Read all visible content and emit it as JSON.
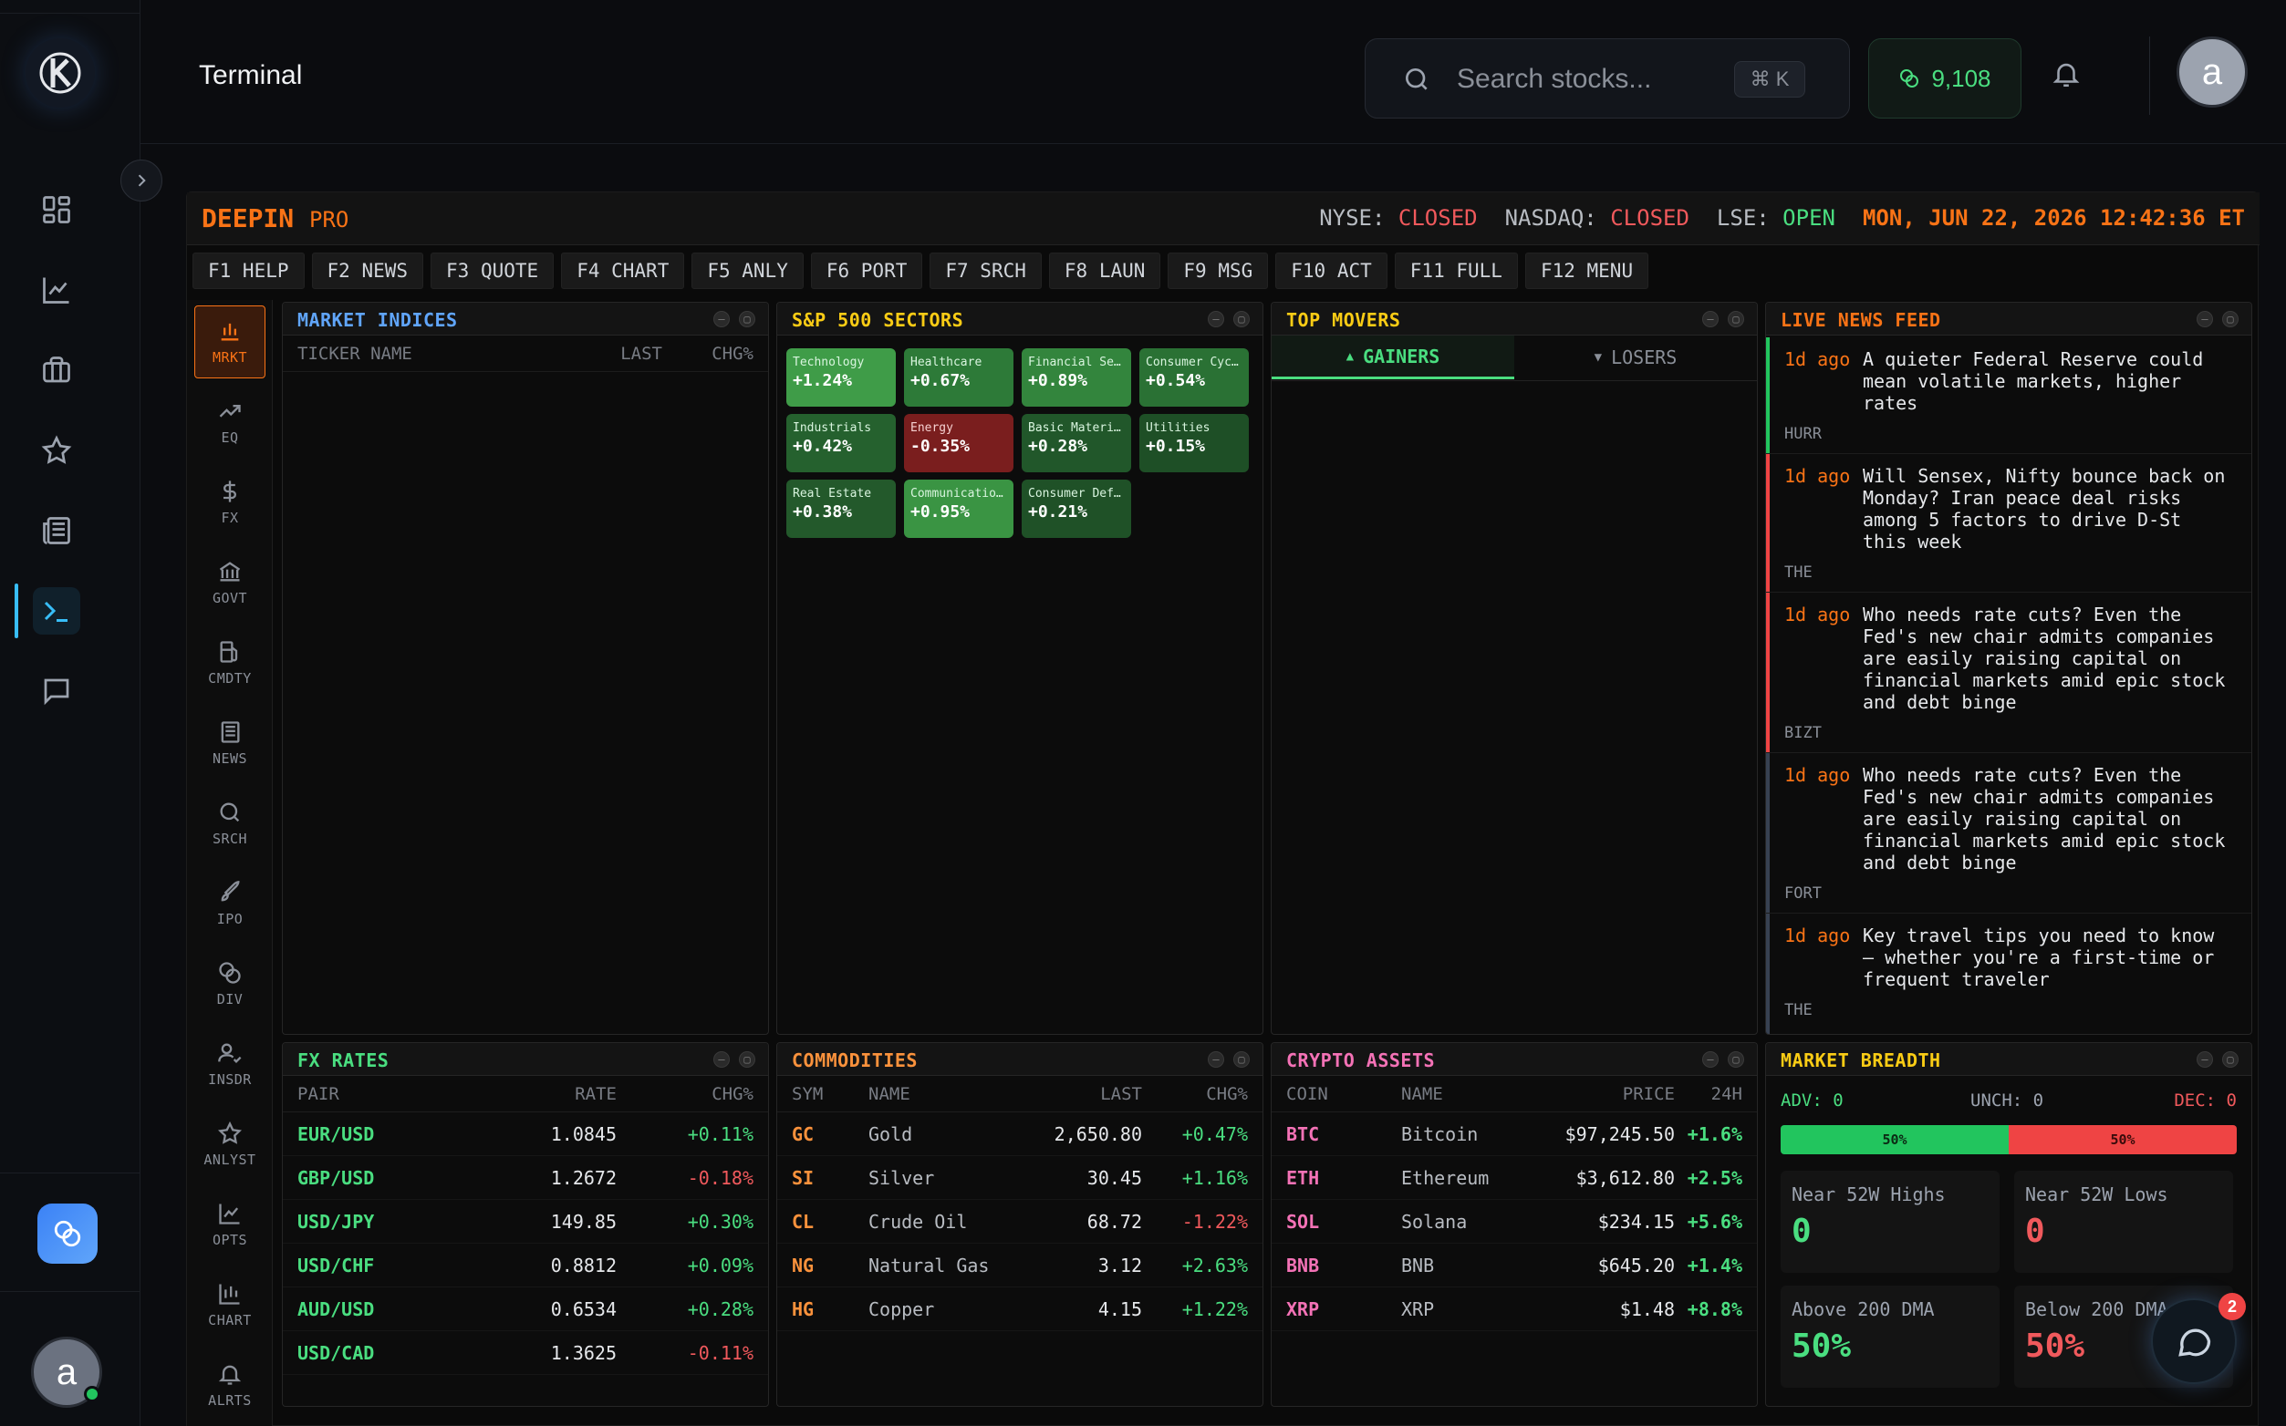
{
  "app": {
    "title": "Terminal",
    "avatar_initial": "a"
  },
  "search": {
    "placeholder": "Search stocks...",
    "shortcut": "⌘ K"
  },
  "credits": {
    "value": "9,108"
  },
  "rail_icons": [
    "dashboard-icon",
    "chart-line-icon",
    "portfolio-icon",
    "star-icon",
    "news-icon",
    "terminal-icon",
    "chat-icon"
  ],
  "terminal": {
    "brand": "DEEPIN",
    "tier": "PRO",
    "markets": [
      {
        "label": "NYSE:",
        "status": "CLOSED"
      },
      {
        "label": "NASDAQ:",
        "status": "CLOSED"
      },
      {
        "label": "LSE:",
        "status": "OPEN"
      }
    ],
    "clock": "MON, JUN 22, 2026 12:42:36 ET",
    "function_keys": [
      "F1 HELP",
      "F2 NEWS",
      "F3 QUOTE",
      "F4 CHART",
      "F5 ANLY",
      "F6 PORT",
      "F7 SRCH",
      "F8 LAUN",
      "F9 MSG",
      "F10 ACT",
      "F11 FULL",
      "F12 MENU"
    ],
    "functions": [
      "MRKT",
      "EQ",
      "FX",
      "GOVT",
      "CMDTY",
      "NEWS",
      "SRCH",
      "IPO",
      "DIV",
      "INSDR",
      "ANLYST",
      "OPTS",
      "CHART",
      "ALRTS"
    ]
  },
  "market_indices": {
    "title": "MARKET INDICES",
    "columns": [
      "TICKER NAME",
      "LAST",
      "CHG%"
    ]
  },
  "sectors": {
    "title": "S&P 500 SECTORS",
    "items": [
      {
        "name": "Technology",
        "change": "+1.24%"
      },
      {
        "name": "Healthcare",
        "change": "+0.67%"
      },
      {
        "name": "Financial Ser…",
        "change": "+0.89%"
      },
      {
        "name": "Consumer Cycl…",
        "change": "+0.54%"
      },
      {
        "name": "Industrials",
        "change": "+0.42%"
      },
      {
        "name": "Energy",
        "change": "-0.35%"
      },
      {
        "name": "Basic Materia…",
        "change": "+0.28%"
      },
      {
        "name": "Utilities",
        "change": "+0.15%"
      },
      {
        "name": "Real Estate",
        "change": "+0.38%"
      },
      {
        "name": "Communication…",
        "change": "+0.95%"
      },
      {
        "name": "Consumer Defe…",
        "change": "+0.21%"
      }
    ]
  },
  "movers": {
    "title": "TOP MOVERS",
    "tabs": [
      "GAINERS",
      "LOSERS"
    ]
  },
  "news": {
    "title": "LIVE NEWS FEED",
    "items": [
      {
        "age": "1d ago",
        "headline": "A quieter Federal Reserve could mean volatile markets, higher rates",
        "source": "HURR"
      },
      {
        "age": "1d ago",
        "headline": "Will Sensex, Nifty bounce back on Monday? Iran peace deal risks among 5 factors to drive D-St this week",
        "source": "THE"
      },
      {
        "age": "1d ago",
        "headline": "Who needs rate cuts? Even the Fed's new chair admits companies are easily raising capital on financial markets amid epic stock and debt binge",
        "source": "BIZT"
      },
      {
        "age": "1d ago",
        "headline": "Who needs rate cuts? Even the Fed's new chair admits companies are easily raising capital on financial markets amid epic stock and debt binge",
        "source": "FORT"
      },
      {
        "age": "1d ago",
        "headline": "Key travel tips you need to know — whether you're a first-time or frequent traveler",
        "source": "THE"
      }
    ]
  },
  "fx": {
    "title": "FX RATES",
    "columns": [
      "PAIR",
      "RATE",
      "CHG%"
    ],
    "rows": [
      {
        "pair": "EUR/USD",
        "rate": "1.0845",
        "chg": "+0.11%"
      },
      {
        "pair": "GBP/USD",
        "rate": "1.2672",
        "chg": "-0.18%"
      },
      {
        "pair": "USD/JPY",
        "rate": "149.85",
        "chg": "+0.30%"
      },
      {
        "pair": "USD/CHF",
        "rate": "0.8812",
        "chg": "+0.09%"
      },
      {
        "pair": "AUD/USD",
        "rate": "0.6534",
        "chg": "+0.28%"
      },
      {
        "pair": "USD/CAD",
        "rate": "1.3625",
        "chg": "-0.11%"
      }
    ]
  },
  "commodities": {
    "title": "COMMODITIES",
    "columns": [
      "SYM",
      "NAME",
      "LAST",
      "CHG%"
    ],
    "rows": [
      {
        "sym": "GC",
        "name": "Gold",
        "last": "2,650.80",
        "chg": "+0.47%"
      },
      {
        "sym": "SI",
        "name": "Silver",
        "last": "30.45",
        "chg": "+1.16%"
      },
      {
        "sym": "CL",
        "name": "Crude Oil",
        "last": "68.72",
        "chg": "-1.22%"
      },
      {
        "sym": "NG",
        "name": "Natural Gas",
        "last": "3.12",
        "chg": "+2.63%"
      },
      {
        "sym": "HG",
        "name": "Copper",
        "last": "4.15",
        "chg": "+1.22%"
      }
    ]
  },
  "crypto": {
    "title": "CRYPTO ASSETS",
    "columns": [
      "COIN",
      "NAME",
      "PRICE",
      "24H"
    ],
    "rows": [
      {
        "coin": "BTC",
        "name": "Bitcoin",
        "price": "$97,245.50",
        "chg": "+1.6%"
      },
      {
        "coin": "ETH",
        "name": "Ethereum",
        "price": "$3,612.80",
        "chg": "+2.5%"
      },
      {
        "coin": "SOL",
        "name": "Solana",
        "price": "$234.15",
        "chg": "+5.6%"
      },
      {
        "coin": "BNB",
        "name": "BNB",
        "price": "$645.20",
        "chg": "+1.4%"
      },
      {
        "coin": "XRP",
        "name": "XRP",
        "price": "$1.48",
        "chg": "+8.8%"
      }
    ]
  },
  "breadth": {
    "title": "MARKET BREADTH",
    "adv": "ADV: 0",
    "unch": "UNCH: 0",
    "dec": "DEC: 0",
    "adv_pct": "50%",
    "dec_pct": "50%",
    "adv_fraction": 0.5,
    "near_highs_label": "Near 52W Highs",
    "near_highs": "0",
    "near_lows_label": "Near 52W Lows",
    "near_lows": "0",
    "above_dma_label": "Above 200 DMA",
    "above_dma": "50%",
    "below_dma_label": "Below 200 DMA",
    "below_dma": "50%"
  },
  "chat": {
    "badge": "2"
  },
  "colors": {
    "accent": "#f97316",
    "up": "#4ade80",
    "down": "#f0595c",
    "link": "#38bdf8"
  }
}
